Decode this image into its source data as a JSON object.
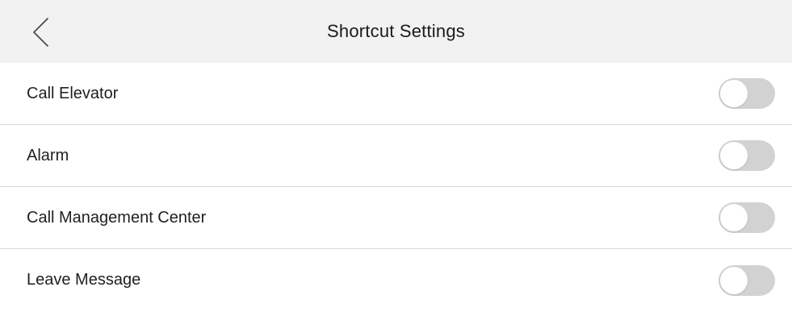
{
  "header": {
    "title": "Shortcut Settings",
    "back_icon": "chevron-left-icon"
  },
  "settings": {
    "items": [
      {
        "label": "Call Elevator",
        "enabled": false
      },
      {
        "label": "Alarm",
        "enabled": false
      },
      {
        "label": "Call Management Center",
        "enabled": false
      },
      {
        "label": "Leave Message",
        "enabled": false
      }
    ]
  },
  "colors": {
    "header_bg": "#f2f2f2",
    "toggle_off": "#d2d2d2",
    "divider": "#d6d6d6"
  }
}
